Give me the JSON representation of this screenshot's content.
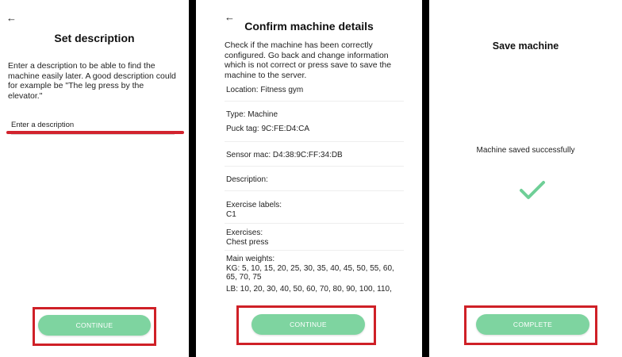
{
  "screens": {
    "set_description": {
      "back_icon": "←",
      "title": "Set description",
      "body": "Enter a description to be able to find the machine easily later. A good description could for example be \"The leg press by the elevator.\"",
      "input_placeholder": "Enter a description",
      "continue_label": "CONTINUE"
    },
    "confirm": {
      "back_icon": "←",
      "title": "Confirm machine details",
      "intro": "Check if the machine has been correctly configured. Go back and change information which is not correct or press save to save the machine to the server.",
      "location": "Location: Fitness gym",
      "type": "Type: Machine",
      "puck_tag": "Puck tag: 9C:FE:D4:CA",
      "sensor_mac": "Sensor mac: D4:38:9C:FF:34:DB",
      "description": "Description:",
      "exercise_labels_heading": "Exercise labels:",
      "exercise_labels_value": "C1",
      "exercises_heading": "Exercises:",
      "exercises_value": "Chest press",
      "main_weights_heading": "Main weights:",
      "kg_weights": "KG: 5, 10, 15, 20, 25, 30, 35, 40, 45, 50, 55, 60, 65, 70, 75",
      "lb_weights": "LB: 10, 20, 30, 40, 50, 60, 70, 80, 90, 100, 110,",
      "continue_label": "CONTINUE"
    },
    "save": {
      "title": "Save machine",
      "status": "Machine saved successfully",
      "complete_label": "COMPLETE"
    }
  },
  "colors": {
    "accent_green": "#7ed4a0",
    "check_green": "#6fcf97",
    "highlight_red": "#cf2027",
    "separator": "#000000"
  }
}
